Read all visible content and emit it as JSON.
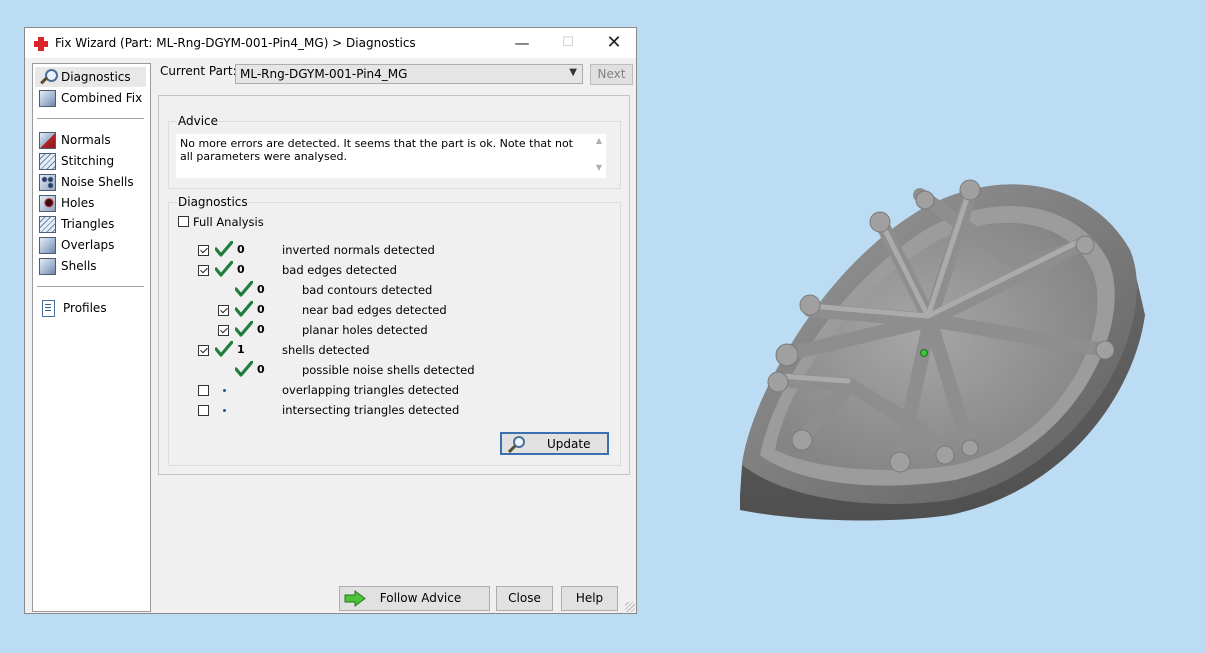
{
  "window": {
    "title": "Fix Wizard (Part: ML-Rng-DGYM-001-Pin4_MG) > Diagnostics",
    "minimize_glyph": "—",
    "maximize_glyph": "☐",
    "close_glyph": "✕"
  },
  "sidebar": {
    "items": [
      {
        "label": "Diagnostics",
        "icon": "magnifier-icon"
      },
      {
        "label": "Combined Fix",
        "icon": "cube-stack-icon"
      },
      {
        "label": "Normals",
        "icon": "cube-red-face-icon"
      },
      {
        "label": "Stitching",
        "icon": "cube-stitch-icon"
      },
      {
        "label": "Noise Shells",
        "icon": "cube-dots-icon"
      },
      {
        "label": "Holes",
        "icon": "cube-hole-icon"
      },
      {
        "label": "Triangles",
        "icon": "cube-triangles-icon"
      },
      {
        "label": "Overlaps",
        "icon": "cube-overlap-icon"
      },
      {
        "label": "Shells",
        "icon": "cube-shell-icon"
      },
      {
        "label": "Profiles",
        "icon": "document-icon"
      }
    ]
  },
  "current_part": {
    "label": "Current Part:",
    "value": "ML-Rng-DGYM-001-Pin4_MG",
    "next_label": "Next"
  },
  "advice": {
    "legend": "Advice",
    "text": "No more errors are detected. It seems that the part is ok. Note that not all parameters were analysed."
  },
  "diagnostics": {
    "legend": "Diagnostics",
    "full_analysis_label": "Full Analysis",
    "rows": [
      {
        "count": "0",
        "label": "inverted normals detected"
      },
      {
        "count": "0",
        "label": "bad edges detected"
      },
      {
        "count": "0",
        "label": "bad contours detected"
      },
      {
        "count": "0",
        "label": "near bad edges detected"
      },
      {
        "count": "0",
        "label": "planar holes detected"
      },
      {
        "count": "1",
        "label": "shells detected"
      },
      {
        "count": "0",
        "label": "possible noise shells detected"
      },
      {
        "count": "",
        "label": "overlapping triangles detected"
      },
      {
        "count": "",
        "label": "intersecting triangles detected"
      }
    ],
    "update_label": "Update"
  },
  "footer": {
    "follow_advice_label": "Follow Advice",
    "close_label": "Close",
    "help_label": "Help"
  },
  "colors": {
    "desktop": "#bcdcf4",
    "tick_green": "#1e7d3a",
    "focus_blue": "#3a6fb0"
  }
}
